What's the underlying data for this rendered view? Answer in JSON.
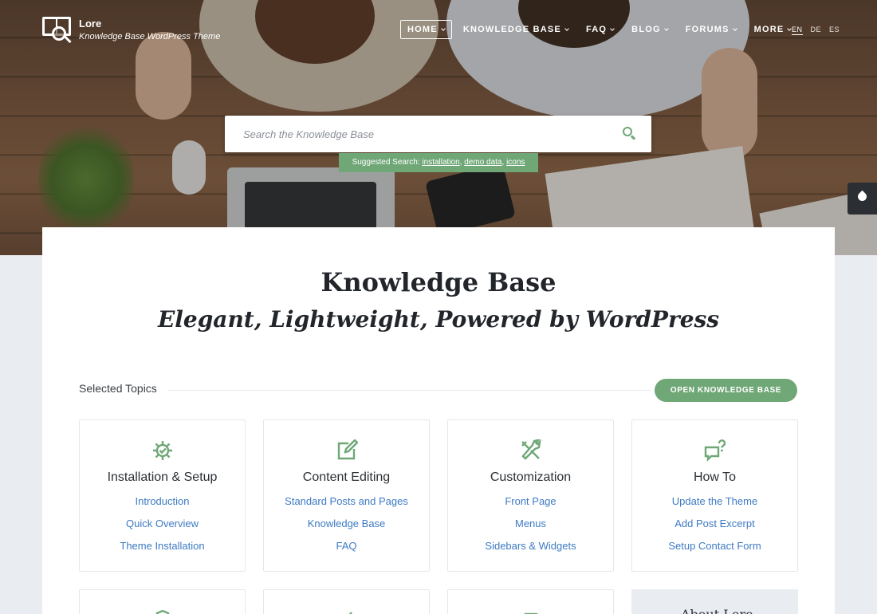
{
  "brand": {
    "name": "Lore",
    "tagline": "Knowledge Base WordPress Theme"
  },
  "nav": {
    "items": [
      {
        "label": "HOME"
      },
      {
        "label": "KNOWLEDGE BASE"
      },
      {
        "label": "FAQ"
      },
      {
        "label": "BLOG"
      },
      {
        "label": "FORUMS"
      },
      {
        "label": "MORE"
      }
    ],
    "languages": [
      "EN",
      "DE",
      "ES"
    ]
  },
  "search": {
    "placeholder": "Search the Knowledge Base",
    "suggested_label": "Suggested Search:",
    "suggestions": [
      "installation",
      "demo data",
      "icons"
    ]
  },
  "hero": {
    "title": "Knowledge Base",
    "subtitle": "Elegant, Lightweight, Powered by WordPress"
  },
  "topics_section": {
    "label": "Selected Topics",
    "button_label": "OPEN KNOWLEDGE BASE"
  },
  "topics": [
    {
      "title": "Installation & Setup",
      "icon": "gear-check-icon",
      "links": [
        "Introduction",
        "Quick Overview",
        "Theme Installation"
      ]
    },
    {
      "title": "Content Editing",
      "icon": "edit-icon",
      "links": [
        "Standard Posts and Pages",
        "Knowledge Base",
        "FAQ"
      ]
    },
    {
      "title": "Customization",
      "icon": "tools-icon",
      "links": [
        "Front Page",
        "Menus",
        "Sidebars & Widgets"
      ]
    },
    {
      "title": "How To",
      "icon": "chat-question-icon",
      "links": [
        "Update the Theme",
        "Add Post Excerpt",
        "Setup Contact Form"
      ]
    }
  ],
  "about": {
    "label": "About Lore"
  },
  "colors": {
    "accent": "#6fa777",
    "link": "#3d7ac3",
    "heading": "#22262b"
  }
}
